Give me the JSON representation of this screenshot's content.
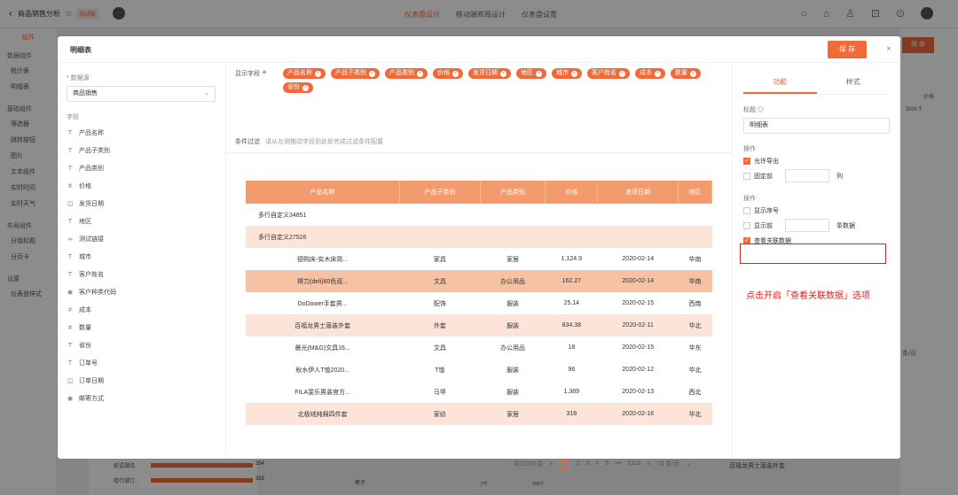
{
  "topbar": {
    "title": "商品销售分析",
    "badge": "测试版",
    "tabs": [
      "仪表盘设计",
      "移动端布局设计",
      "仪表盘设置"
    ]
  },
  "bg_left": {
    "tab": "组件",
    "sections": [
      {
        "title": "数据组件",
        "items": [
          "统计表",
          "明细表"
        ]
      },
      {
        "title": "基础组件",
        "items": [
          "筛选器",
          "跳转按钮",
          "图片",
          "文本组件",
          "实时时间",
          "实时天气"
        ]
      },
      {
        "title": "布局组件",
        "items": [
          "分组标题",
          "分页卡"
        ]
      },
      {
        "title": "设置",
        "items": [
          "仪表盘样式"
        ]
      }
    ]
  },
  "bg_right": {
    "save": "保 存",
    "label_a": "价格",
    "label_b": "3000千",
    "page_size": "条/页"
  },
  "bg_bottom": {
    "row1": "纸语潮流..",
    "val1": "354",
    "row2": "楼行潮订..",
    "val2": "355",
    "mid": "裤子",
    "small_a": "2千",
    "small_b": "209千",
    "right_label": "百福龙男士唐装外套"
  },
  "modal": {
    "title": "明细表",
    "save": "保 存",
    "close": "×"
  },
  "left_panel": {
    "datasource_label": "数据源",
    "datasource": "商品销售",
    "fields_label": "字段",
    "fields": [
      {
        "icon": "T",
        "name": "产品名称"
      },
      {
        "icon": "T",
        "name": "产品子类别"
      },
      {
        "icon": "T",
        "name": "产品类别"
      },
      {
        "icon": "#",
        "name": "价格"
      },
      {
        "icon": "◫",
        "name": "发货日期"
      },
      {
        "icon": "T",
        "name": "地区"
      },
      {
        "icon": "∞",
        "name": "测试链接"
      },
      {
        "icon": "T",
        "name": "城市"
      },
      {
        "icon": "T",
        "name": "客户姓名"
      },
      {
        "icon": "◉",
        "name": "客户种类代码"
      },
      {
        "icon": "#",
        "name": "成本"
      },
      {
        "icon": "#",
        "name": "数量"
      },
      {
        "icon": "T",
        "name": "省份"
      },
      {
        "icon": "T",
        "name": "订单号"
      },
      {
        "icon": "◫",
        "name": "订单日期"
      },
      {
        "icon": "◉",
        "name": "邮寄方式"
      }
    ]
  },
  "center": {
    "show_label": "显示字段",
    "tags": [
      "产品名称",
      "产品子类别",
      "产品类别",
      "价格",
      "发货日期",
      "地区",
      "城市",
      "客户姓名",
      "成本",
      "数量",
      "省份"
    ],
    "filter_label": "条件过滤",
    "filter_hint": "请从左侧拖动字段到此处完成过滤条件配置",
    "columns": [
      "产品名称",
      "产品子类别",
      "产品类别",
      "价格",
      "发货日期",
      "地区"
    ],
    "rows": [
      [
        "多行自定义34851",
        "",
        "",
        "",
        "",
        ""
      ],
      [
        "多行自定义27526",
        "",
        "",
        "",
        "",
        ""
      ],
      [
        "德购床-实木床简...",
        "家具",
        "家居",
        "1,124.9",
        "2020-02-14",
        "华南"
      ],
      [
        "得力(deli)60色双...",
        "文具",
        "办公用品",
        "162.27",
        "2020-02-14",
        "华南"
      ],
      [
        "DoDower手套男...",
        "配饰",
        "服装",
        "25.14",
        "2020-02-15",
        "西南"
      ],
      [
        "百福龙男士唐装外套",
        "外套",
        "服装",
        "834.38",
        "2020-02-11",
        "华北"
      ],
      [
        "晨光(M&G)文具16...",
        "文具",
        "办公用品",
        "18",
        "2020-02-15",
        "华东"
      ],
      [
        "秋水伊人T恤2020...",
        "T恤",
        "服装",
        "96",
        "2020-02-12",
        "华北"
      ],
      [
        "FILA斐乐男装官方...",
        "马甲",
        "服装",
        "1,389",
        "2020-02-13",
        "西北"
      ],
      [
        "北极绒纯棉四件套",
        "家纺",
        "家居",
        "318",
        "2020-02-16",
        "华北"
      ]
    ],
    "pager": {
      "total": "共21091条",
      "pages": [
        "1",
        "2",
        "3",
        "4",
        "5",
        "•••",
        "2110"
      ],
      "prev": "<",
      "next": ">",
      "size": "10 条/页"
    }
  },
  "right_panel": {
    "tabs": [
      "功能",
      "样式"
    ],
    "title_label": "标题",
    "title_value": "明细表",
    "op1": "操作",
    "allow_export": "允许导出",
    "fix_prefix": "固定前",
    "fix_suffix": "列",
    "op2": "操作",
    "show_index": "显示序号",
    "show_prefix": "显示前",
    "show_suffix": "条数据",
    "view_related": "查看关联数据"
  },
  "annotation": "点击开启「查看关联数据」选项",
  "colors": {
    "accent": "#f26a3a",
    "highlight": "#e02020"
  }
}
